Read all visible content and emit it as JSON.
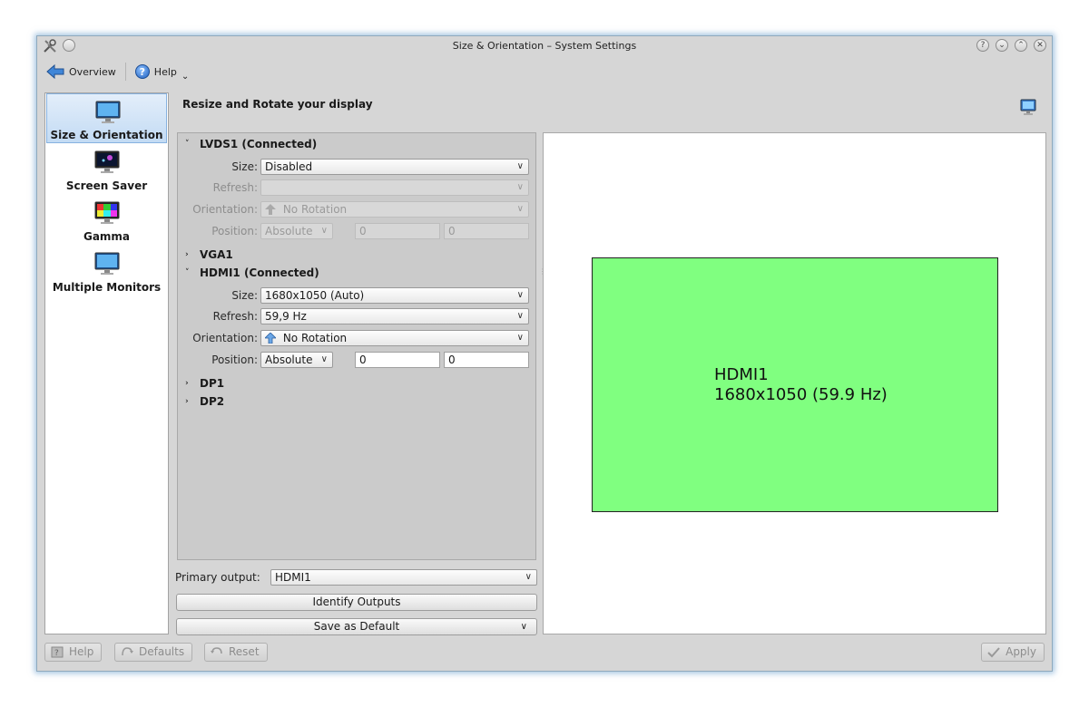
{
  "window": {
    "title": "Size & Orientation – System Settings"
  },
  "toolbar": {
    "overview_label": "Overview",
    "help_label": "Help"
  },
  "sidebar": {
    "items": [
      {
        "label": "Size & Orientation",
        "active": true
      },
      {
        "label": "Screen Saver"
      },
      {
        "label": "Gamma"
      },
      {
        "label": "Multiple Monitors"
      }
    ]
  },
  "main": {
    "heading": "Resize and Rotate your display",
    "outputs": [
      {
        "name": "LVDS1 (Connected)",
        "expanded": true,
        "size_label": "Size:",
        "size_value": "Disabled",
        "refresh_label": "Refresh:",
        "refresh_value": "",
        "orientation_label": "Orientation:",
        "orientation_value": "No Rotation",
        "position_label": "Position:",
        "position_mode": "Absolute",
        "position_x": "0",
        "position_y": "0"
      },
      {
        "name": "VGA1",
        "expanded": false
      },
      {
        "name": "HDMI1 (Connected)",
        "expanded": true,
        "size_label": "Size:",
        "size_value": "1680x1050 (Auto)",
        "refresh_label": "Refresh:",
        "refresh_value": "59,9 Hz",
        "orientation_label": "Orientation:",
        "orientation_value": "No Rotation",
        "position_label": "Position:",
        "position_mode": "Absolute",
        "position_x": "0",
        "position_y": "0"
      },
      {
        "name": "DP1",
        "expanded": false
      },
      {
        "name": "DP2",
        "expanded": false
      }
    ],
    "primary_output_label": "Primary output:",
    "primary_output_value": "HDMI1",
    "identify_label": "Identify Outputs",
    "save_default_label": "Save as Default"
  },
  "preview": {
    "screen_name": "HDMI1",
    "screen_mode": "1680x1050 (59.9 Hz)",
    "screen_color": "#80ff80"
  },
  "footer": {
    "help_label": "Help",
    "defaults_label": "Defaults",
    "reset_label": "Reset",
    "apply_label": "Apply"
  },
  "colors": {
    "accent": "#87b2e0",
    "window_glow": "#5a96c8"
  }
}
